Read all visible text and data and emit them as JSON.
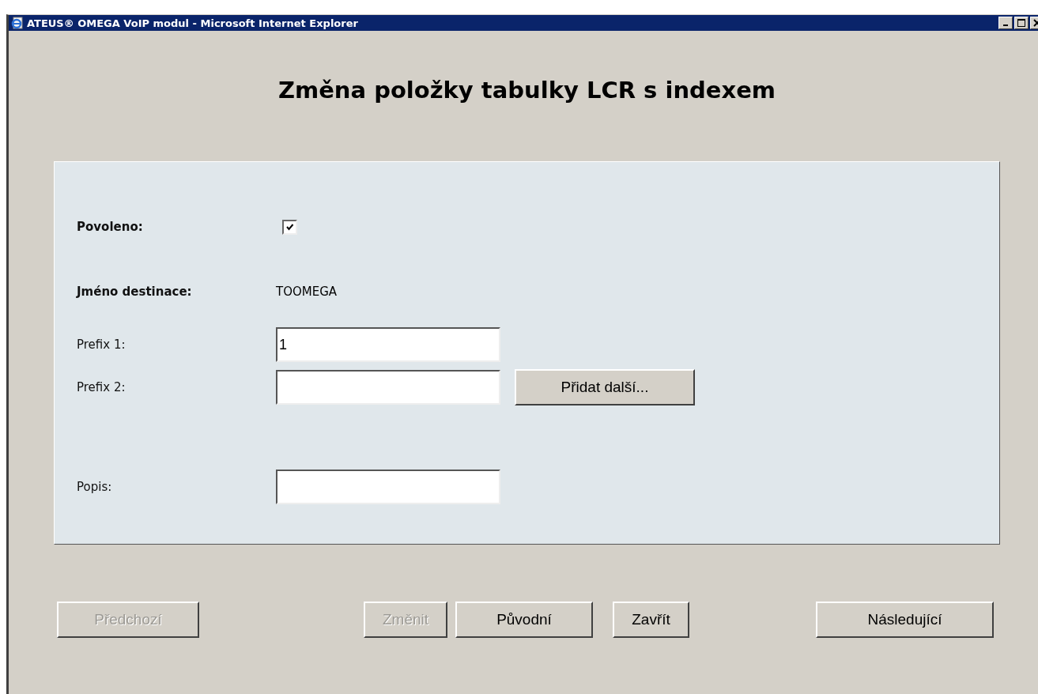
{
  "window": {
    "title": "ATEUS® OMEGA VoIP modul - Microsoft Internet Explorer"
  },
  "heading": "Změna položky tabulky LCR s indexem",
  "fields": [
    {
      "kind": "checkbox",
      "label": "Povoleno:",
      "checked": true
    },
    {
      "kind": "text",
      "label": "Jméno destinace:",
      "value": "TOOMEGA"
    },
    {
      "kind": "input",
      "label": "Prefix 1:",
      "value": "1"
    },
    {
      "kind": "input",
      "label": "Prefix 2:",
      "button": "Přidat další..."
    },
    {
      "kind": "input",
      "label": "Popis:"
    }
  ],
  "buttons": [
    {
      "label": "Předchozí",
      "disabled": true
    },
    {
      "label": "Změnit",
      "disabled": true
    },
    {
      "label": "Původní",
      "disabled": false
    },
    {
      "label": "Zavřít",
      "disabled": false
    },
    {
      "label": "Následující",
      "disabled": false
    }
  ]
}
